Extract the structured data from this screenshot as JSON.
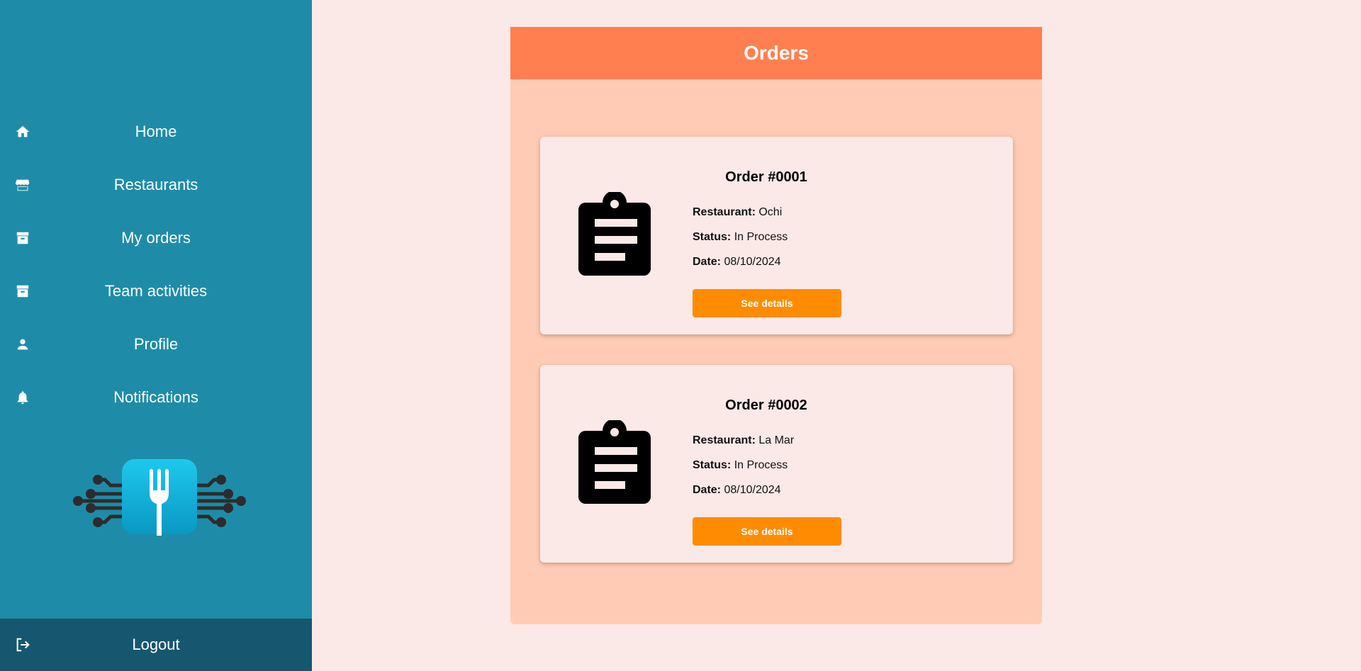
{
  "sidebar": {
    "items": [
      {
        "label": "Home",
        "icon": "home-icon"
      },
      {
        "label": "Restaurants",
        "icon": "store-icon"
      },
      {
        "label": "My orders",
        "icon": "archive-icon"
      },
      {
        "label": "Team activities",
        "icon": "archive-icon"
      },
      {
        "label": "Profile",
        "icon": "person-icon"
      },
      {
        "label": "Notifications",
        "icon": "bell-icon"
      }
    ],
    "logout_label": "Logout"
  },
  "main": {
    "title": "Orders",
    "orders": [
      {
        "title": "Order #0001",
        "restaurant_label": "Restaurant:",
        "restaurant": "Ochi",
        "status_label": "Status:",
        "status": "In Process",
        "date_label": "Date:",
        "date": "08/10/2024",
        "button_label": "See details"
      },
      {
        "title": "Order #0002",
        "restaurant_label": "Restaurant:",
        "restaurant": "La Mar",
        "status_label": "Status:",
        "status": "In Process",
        "date_label": "Date:",
        "date": "08/10/2024",
        "button_label": "See details"
      }
    ]
  },
  "colors": {
    "sidebar": "#1e8ca8",
    "logout_bar": "#17566f",
    "header": "#ff7f50",
    "panel": "#ffcbb4",
    "button": "#ff8c00",
    "page_bg": "#fae9e6"
  }
}
